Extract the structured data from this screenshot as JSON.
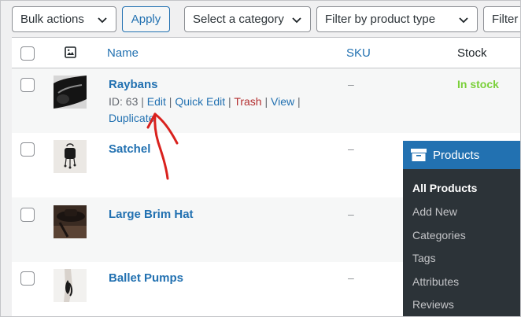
{
  "toolbar": {
    "bulk_actions": "Bulk actions",
    "apply": "Apply",
    "category": "Select a category",
    "product_type": "Filter by product type",
    "filter_partial": "Filter"
  },
  "table": {
    "headers": {
      "name": "Name",
      "sku": "SKU",
      "stock": "Stock"
    },
    "rows": [
      {
        "name": "Raybans",
        "sku": "–",
        "stock": "In stock",
        "row_actions": {
          "id": "ID: 63",
          "sep": "|",
          "edit": "Edit",
          "quick_edit": "Quick Edit",
          "trash": "Trash",
          "view": "View",
          "duplicate": "Duplicate"
        }
      },
      {
        "name": "Satchel",
        "sku": "–"
      },
      {
        "name": "Large Brim Hat",
        "sku": "–"
      },
      {
        "name": "Ballet Pumps",
        "sku": "–"
      }
    ]
  },
  "admin_menu": {
    "title": "Products",
    "items": [
      "All Products",
      "Add New",
      "Categories",
      "Tags",
      "Attributes",
      "Reviews"
    ]
  },
  "colors": {
    "accent": "#2271b1",
    "menu_bg": "#2c3338",
    "in_stock": "#7ad03a",
    "trash": "#b32d2e",
    "annotation": "#d9211d"
  },
  "icons": [
    "chevron-down-icon",
    "image-column-icon",
    "products-archive-icon",
    "hand-drawn-arrow"
  ]
}
